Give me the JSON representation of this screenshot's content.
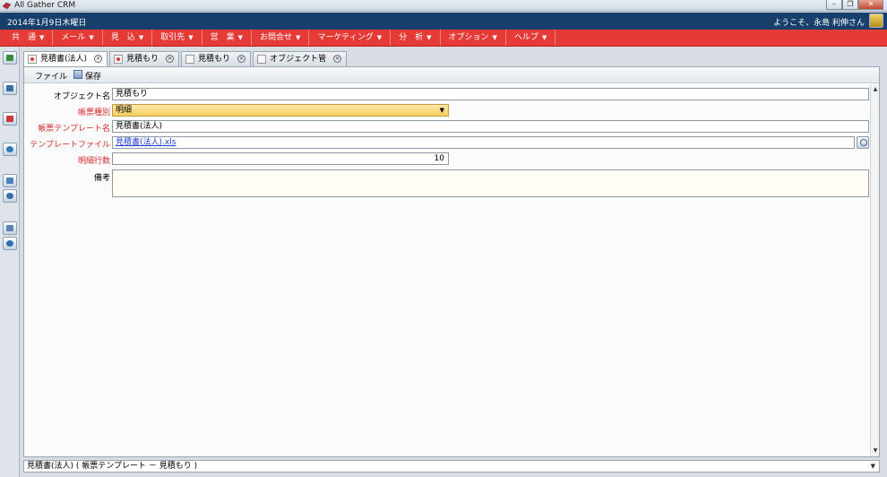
{
  "window": {
    "title": "All Gather CRM",
    "minimize": "–",
    "restore": "❐",
    "close": "✕"
  },
  "header": {
    "date": "2014年1月9日木曜日",
    "welcome": "ようこそ、永島 利伸さん"
  },
  "menu": [
    {
      "label": "共　通"
    },
    {
      "label": "メール"
    },
    {
      "label": "見　込"
    },
    {
      "label": "取引先"
    },
    {
      "label": "営　業"
    },
    {
      "label": "お問合せ"
    },
    {
      "label": "マーケティング"
    },
    {
      "label": "分　析"
    },
    {
      "label": "オプション"
    },
    {
      "label": "ヘルプ"
    }
  ],
  "menu_caret": "▼",
  "tabs": [
    {
      "label": "見積書(法人)",
      "active": true
    },
    {
      "label": "見積もり",
      "active": false
    },
    {
      "label": "見積もり",
      "active": false
    },
    {
      "label": "オブジェクト管",
      "active": false
    }
  ],
  "tab_close": "×",
  "toolbar": {
    "file": "ファイル",
    "save": "保存"
  },
  "form": {
    "object_name_label": "オブジェクト名",
    "object_name_value": "見積もり",
    "form_type_label": "帳票種別",
    "form_type_value": "明細",
    "template_name_label": "帳票テンプレート名",
    "template_name_value": "見積書(法人)",
    "template_file_label": "テンプレートファイル",
    "template_file_value": "見積書(法人).xls",
    "detail_rows_label": "明細行数",
    "detail_rows_value": "10",
    "note_label": "備考",
    "note_value": ""
  },
  "dropdown_arrow": "▼",
  "scroll": {
    "up": "▲",
    "down": "▼"
  },
  "status": {
    "value": "見積書(法人) ( 帳票テンプレート － 見積もり )"
  },
  "colors": {
    "header_blue": "#173f6b",
    "menu_red": "#e53a35",
    "required_label": "#d62a2a",
    "select_fill": "#f7cf63"
  }
}
